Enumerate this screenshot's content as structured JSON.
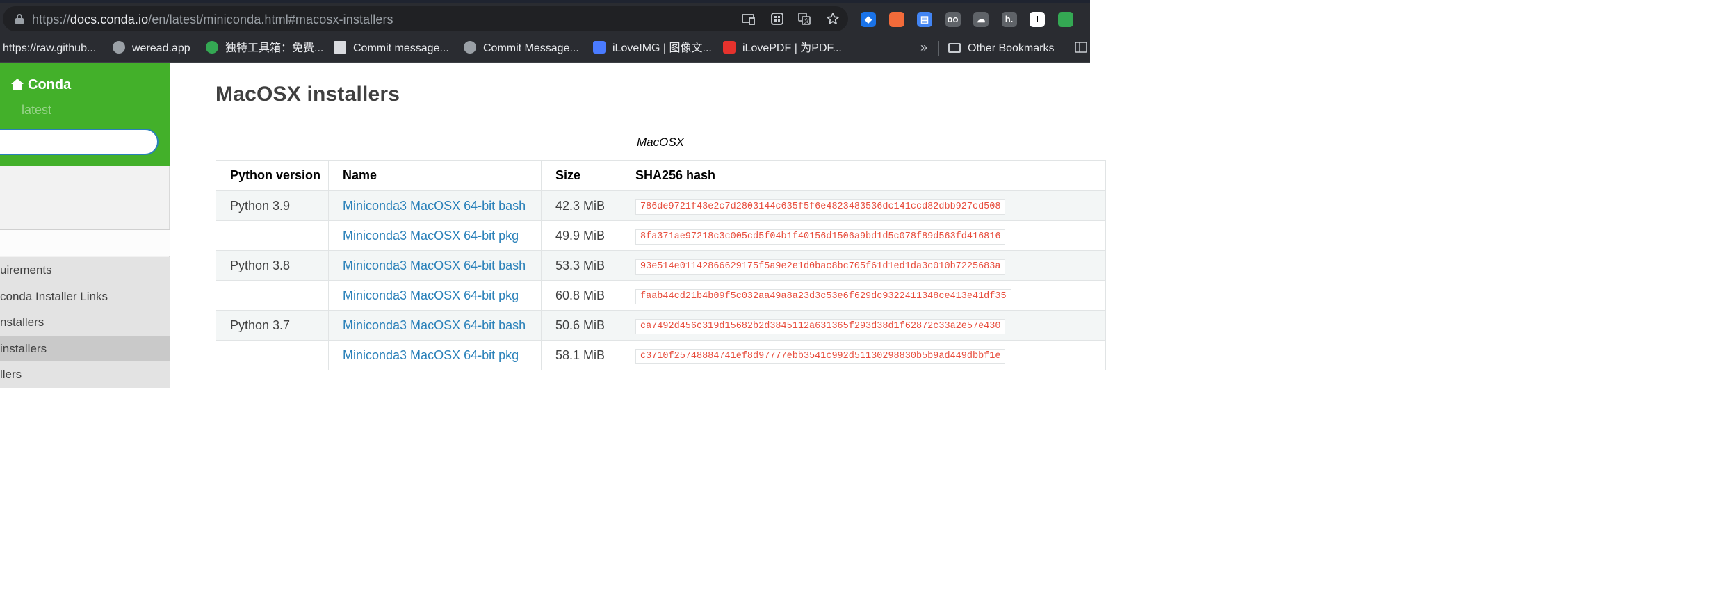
{
  "browser": {
    "url_scheme": "https://",
    "url_host": "docs.conda.io",
    "url_path": "/en/latest/miniconda.html#macosx-installers",
    "extensions": [
      {
        "name": "gem-extension-icon",
        "color": "#1a73e8",
        "glyph": "◆"
      },
      {
        "name": "orange-extension-icon",
        "color": "#f26b3a",
        "glyph": ""
      },
      {
        "name": "download-doc-extension-icon",
        "color": "#4285f4",
        "glyph": "▤"
      },
      {
        "name": "glasses-extension-icon",
        "color": "#5f6368",
        "glyph": "oo"
      },
      {
        "name": "cloud-extension-icon",
        "color": "#5f6368",
        "glyph": "☁"
      },
      {
        "name": "h-extension-icon",
        "color": "#5f6368",
        "glyph": "h."
      },
      {
        "name": "i-extension-icon",
        "color": "#ffffff",
        "glyph": "I"
      },
      {
        "name": "color-wheel-extension-icon",
        "color": "#34a853",
        "glyph": ""
      }
    ]
  },
  "bookmarks": {
    "items": [
      {
        "label": "https://raw.github...",
        "color": ""
      },
      {
        "label": "weread.app",
        "color": "#9aa0a6"
      },
      {
        "label": "独特工具箱：免费...",
        "color": "#34a853"
      },
      {
        "label": "Commit message...",
        "color": "#dadce0"
      },
      {
        "label": "Commit Message...",
        "color": "#9aa0a6"
      },
      {
        "label": "iLoveIMG | 图像文...",
        "color": "#4a7bff"
      },
      {
        "label": "iLovePDF | 为PDF...",
        "color": "#e5322d"
      }
    ],
    "more": "»",
    "other": "Other Bookmarks"
  },
  "sidebar": {
    "project": "Conda",
    "version": "latest",
    "nav": [
      {
        "label": "uirements",
        "active": false
      },
      {
        "label": "conda Installer Links",
        "active": false
      },
      {
        "label": "nstallers",
        "active": false
      },
      {
        "label": "installers",
        "active": true
      },
      {
        "label": "llers",
        "active": false
      }
    ]
  },
  "main": {
    "heading": "MacOSX installers",
    "table_caption": "MacOSX",
    "columns": [
      "Python version",
      "Name",
      "Size",
      "SHA256 hash"
    ],
    "rows": [
      {
        "python": "Python 3.9",
        "name": "Miniconda3 MacOSX 64-bit bash",
        "size": "42.3 MiB",
        "hash": "786de9721f43e2c7d2803144c635f5f6e4823483536dc141ccd82dbb927cd508"
      },
      {
        "python": "",
        "name": "Miniconda3 MacOSX 64-bit pkg",
        "size": "49.9 MiB",
        "hash": "8fa371ae97218c3c005cd5f04b1f40156d1506a9bd1d5c078f89d563fd416816"
      },
      {
        "python": "Python 3.8",
        "name": "Miniconda3 MacOSX 64-bit bash",
        "size": "53.3 MiB",
        "hash": "93e514e01142866629175f5a9e2e1d0bac8bc705f61d1ed1da3c010b7225683a"
      },
      {
        "python": "",
        "name": "Miniconda3 MacOSX 64-bit pkg",
        "size": "60.8 MiB",
        "hash": "faab44cd21b4b09f5c032aa49a8a23d3c53e6f629dc9322411348ce413e41df35"
      },
      {
        "python": "Python 3.7",
        "name": "Miniconda3 MacOSX 64-bit bash",
        "size": "50.6 MiB",
        "hash": "ca7492d456c319d15682b2d3845112a631365f293d38d1f62872c33a2e57e430"
      },
      {
        "python": "",
        "name": "Miniconda3 MacOSX 64-bit pkg",
        "size": "58.1 MiB",
        "hash": "c3710f25748884741ef8d97777ebb3541c992d51130298830b5b9ad449dbbf1e"
      }
    ]
  }
}
